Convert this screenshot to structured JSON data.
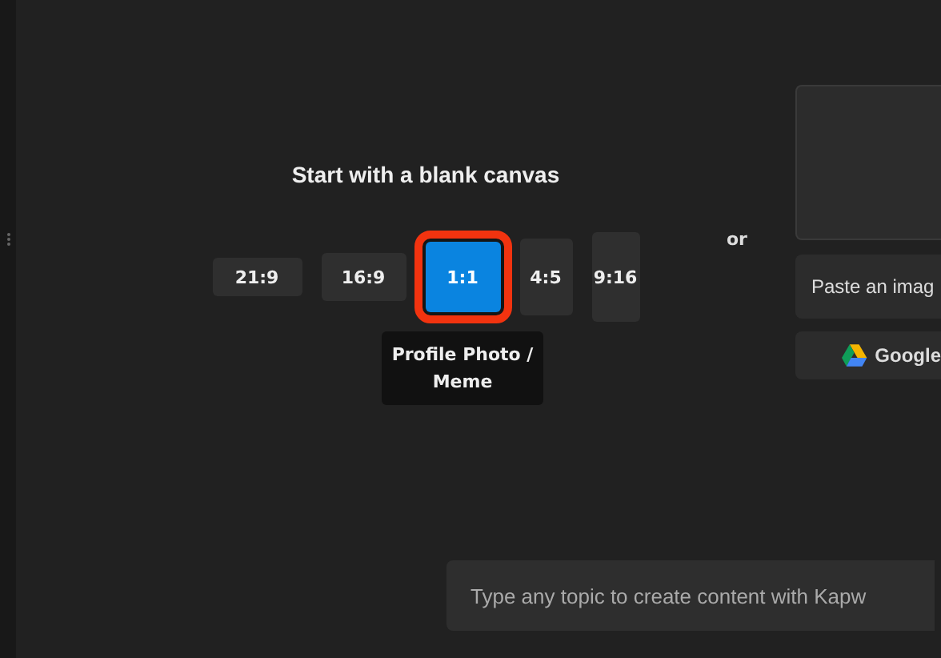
{
  "blank_canvas": {
    "title": "Start with a blank canvas",
    "ratios": [
      {
        "label": "21:9",
        "selected": false
      },
      {
        "label": "16:9",
        "selected": false
      },
      {
        "label": "1:1",
        "selected": true
      },
      {
        "label": "4:5",
        "selected": false
      },
      {
        "label": "9:16",
        "selected": false
      }
    ],
    "tooltip": "Profile Photo / Meme"
  },
  "separator": "or",
  "upload": {
    "paste_button": "Paste an imag",
    "google_button": "Google"
  },
  "prompt": {
    "placeholder": "Type any topic to create content with Kapw"
  }
}
